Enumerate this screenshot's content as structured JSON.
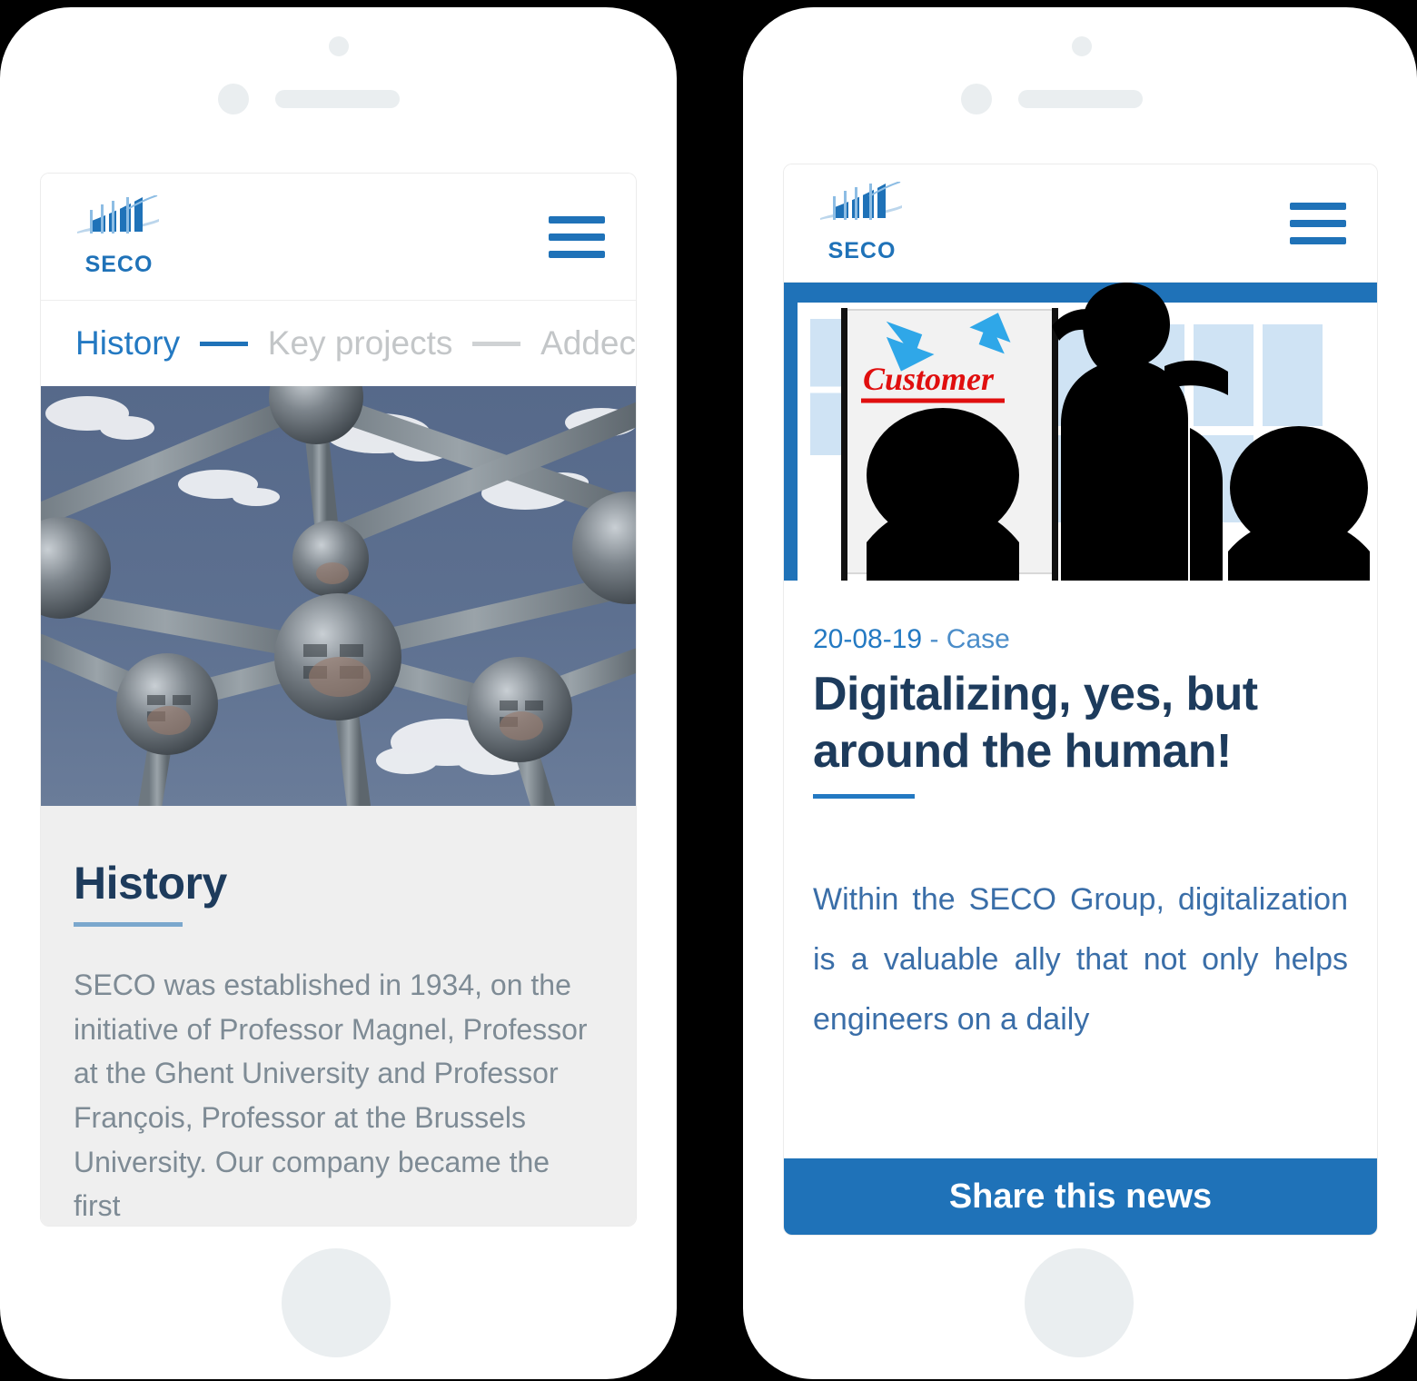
{
  "brand": {
    "name": "SECO",
    "accent_blue": "#1f72b8",
    "heading_navy": "#1d3b5c",
    "muted_gray": "#7e8b95"
  },
  "left_phone": {
    "header": {
      "logo_text": "SECO",
      "menu_label": "Menu"
    },
    "tabs": [
      {
        "label": "History",
        "active": true
      },
      {
        "label": "Key projects",
        "active": false
      },
      {
        "label": "Addec",
        "active": false
      }
    ],
    "hero_image_alt": "Atomium Brussels steel spheres against blue sky",
    "section": {
      "title": "History",
      "body": "SECO was established in 1934, on the initiative of Professor Magnel, Professor at the Ghent University and Professor François, Professor at the Brussels University. Our company became the first"
    }
  },
  "right_phone": {
    "header": {
      "logo_text": "SECO",
      "menu_label": "Menu"
    },
    "article": {
      "image_alt": "Silhouettes of people at a presentation with a Customer flipchart",
      "image_caption_word": "Customer",
      "date": "20-08-19",
      "separator": "-",
      "category": "Case",
      "title": "Digitalizing, yes, but around the human!",
      "body": "Within the SECO Group, digitalization is a valuable ally that not only helps engineers on a daily"
    },
    "share_button": {
      "label": "Share this news"
    }
  }
}
